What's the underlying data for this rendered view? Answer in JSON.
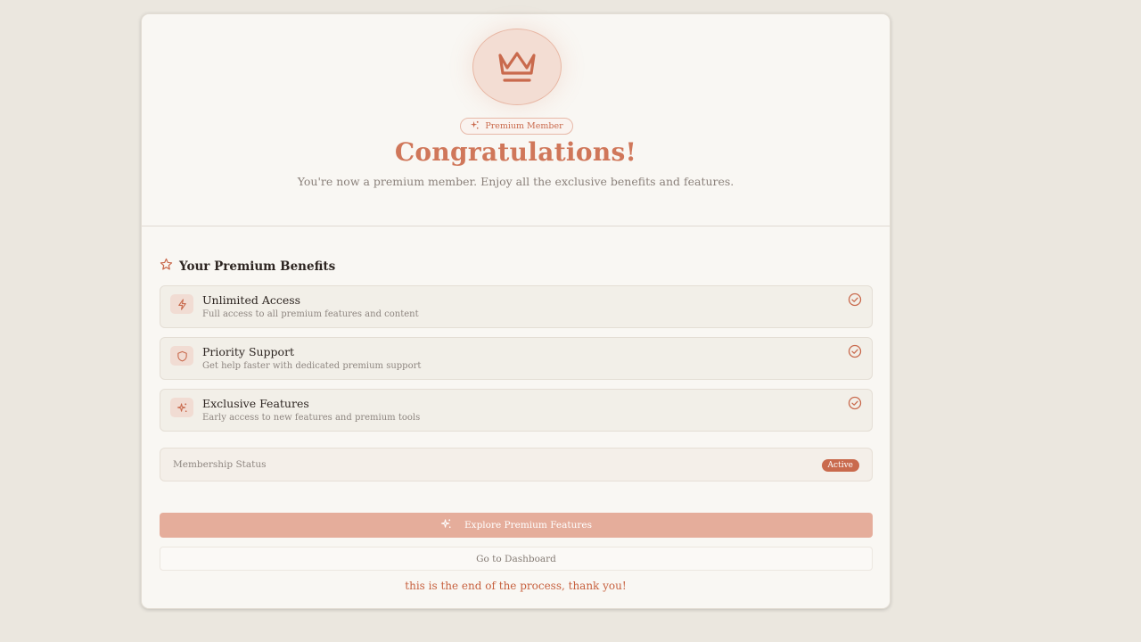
{
  "header": {
    "icon": "crown-icon",
    "badge": {
      "icon": "sparkles-icon",
      "label": "Premium Member"
    },
    "title": "Congratulations!",
    "subtitle": "You're now a premium member. Enjoy all the exclusive benefits and features."
  },
  "benefits": {
    "heading_icon": "star-icon",
    "heading": "Your Premium Benefits",
    "items": [
      {
        "icon": "lightning-icon",
        "name": "Unlimited Access",
        "description": "Full access to all premium features and content",
        "status_icon": "check-circle-icon"
      },
      {
        "icon": "shield-icon",
        "name": "Priority Support",
        "description": "Get help faster with dedicated premium support",
        "status_icon": "check-circle-icon"
      },
      {
        "icon": "sparkles-icon",
        "name": "Exclusive Features",
        "description": "Early access to new features and premium tools",
        "status_icon": "check-circle-icon"
      }
    ]
  },
  "membership": {
    "label": "Membership Status",
    "status": "Active"
  },
  "actions": {
    "primary_label": "Explore Premium Features",
    "primary_icon": "sparkles-icon",
    "secondary_label": "Go to Dashboard"
  },
  "footer_note": "this is the end of the process, thank you!",
  "colors": {
    "accent": "#c96a4d",
    "title": "#d0775a",
    "primary_button": "#e5ad9b",
    "page_background": "#ebe7df",
    "card_background": "#f9f7f3"
  }
}
